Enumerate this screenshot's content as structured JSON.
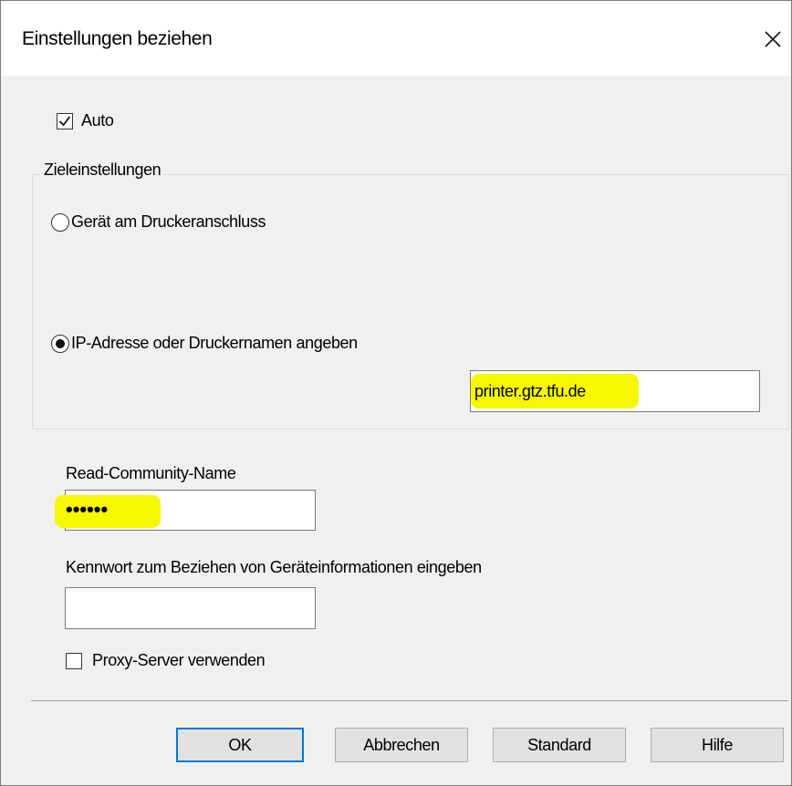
{
  "window": {
    "title": "Einstellungen beziehen",
    "close_icon": "close-icon"
  },
  "auto": {
    "label": "Auto",
    "checked": true
  },
  "target_group": {
    "legend": "Zieleinstellungen",
    "options": [
      {
        "label": "Gerät am Druckeranschluss",
        "selected": false
      },
      {
        "label": "IP-Adresse oder Druckernamen angeben",
        "selected": true
      }
    ],
    "address_value": "printer.gtz.tfu.de"
  },
  "read_community": {
    "label": "Read-Community-Name",
    "value": "••••••"
  },
  "password": {
    "label": "Kennwort zum Beziehen von Geräteinformationen eingeben",
    "value": ""
  },
  "proxy": {
    "label": "Proxy-Server verwenden",
    "checked": false
  },
  "buttons": {
    "ok": "OK",
    "cancel": "Abbrechen",
    "default": "Standard",
    "help": "Hilfe"
  },
  "colors": {
    "highlight": "#f7f700",
    "accent": "#0078d7",
    "background": "#f0f0f0"
  }
}
